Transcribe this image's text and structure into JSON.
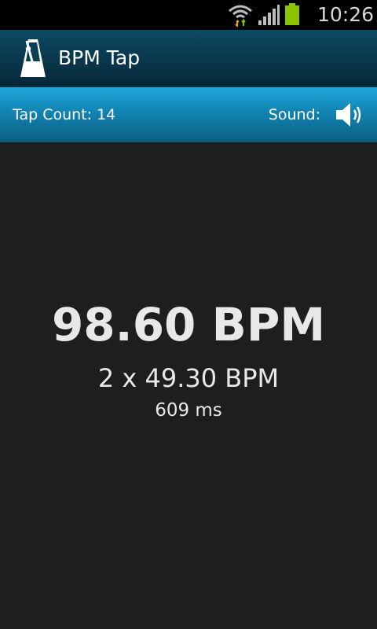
{
  "status_bar": {
    "time": "10:26",
    "battery_color": "#8bc400",
    "icons": [
      "wifi-icon",
      "signal-icon",
      "battery-icon"
    ]
  },
  "action_bar": {
    "title": "BPM Tap",
    "icon": "metronome-icon"
  },
  "info_bar": {
    "tap_count_label": "Tap Count:",
    "tap_count_value": "14",
    "sound_label": "Sound:",
    "sound_icon": "speaker-icon"
  },
  "display": {
    "bpm": "98.60 BPM",
    "half_bpm": "2 x 49.30 BPM",
    "interval": "609 ms"
  },
  "colors": {
    "background": "#1e1e1e",
    "action_bar": "#0a3a50",
    "info_bar": "#1287b6",
    "text": "#e8e8e8"
  }
}
